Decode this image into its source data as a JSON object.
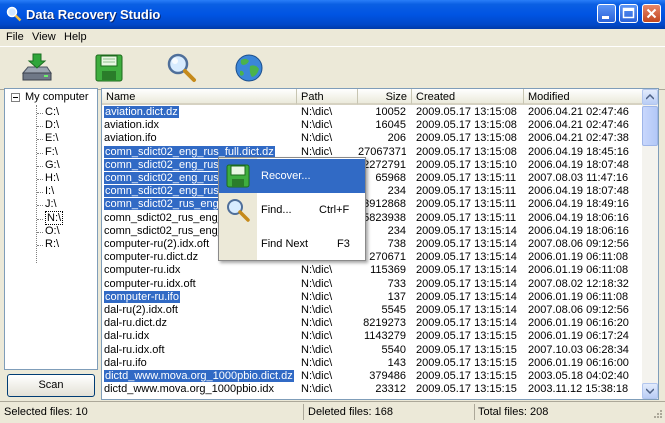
{
  "window": {
    "title": "Data Recovery Studio"
  },
  "menu": [
    "File",
    "View",
    "Help"
  ],
  "toolbar": [
    {
      "icon": "recover-drive-icon"
    },
    {
      "icon": "save-disk-icon"
    },
    {
      "icon": "magnifier-icon"
    },
    {
      "icon": "globe-icon"
    }
  ],
  "tree": {
    "root": "My computer",
    "drives": [
      "C:\\",
      "D:\\",
      "E:\\",
      "F:\\",
      "G:\\",
      "H:\\",
      "I:\\",
      "J:\\",
      "N:\\",
      "O:\\",
      "R:\\"
    ],
    "selected": "N:\\"
  },
  "scan_label": "Scan",
  "columns": {
    "name": "Name",
    "path": "Path",
    "size": "Size",
    "created": "Created",
    "modified": "Modified"
  },
  "rows": [
    {
      "name": "aviation.dict.dz",
      "path": "N:\\dic\\",
      "size": "10052",
      "created": "2009.05.17 13:15:08",
      "modified": "2006.04.21 02:47:46",
      "selected": true
    },
    {
      "name": "aviation.idx",
      "path": "N:\\dic\\",
      "size": "16045",
      "created": "2009.05.17 13:15:08",
      "modified": "2006.04.21 02:47:46",
      "selected": false
    },
    {
      "name": "aviation.ifo",
      "path": "N:\\dic\\",
      "size": "206",
      "created": "2009.05.17 13:15:08",
      "modified": "2006.04.21 02:47:38",
      "selected": false
    },
    {
      "name": "comn_sdict02_eng_rus_full.dict.dz",
      "path": "N:\\dic\\",
      "size": "27067371",
      "created": "2009.05.17 13:15:08",
      "modified": "2006.04.19 18:45:16",
      "selected": true
    },
    {
      "name": "comn_sdict02_eng_rus_full.idx",
      "path": "N:\\dic\\",
      "size": "2272791",
      "created": "2009.05.17 13:15:10",
      "modified": "2006.04.19 18:07:48",
      "selected": true
    },
    {
      "name": "comn_sdict02_eng_rus_full.ifo",
      "path": "N:\\dic\\",
      "size": "65968",
      "created": "2009.05.17 13:15:11",
      "modified": "2007.08.03 11:47:16",
      "selected": true
    },
    {
      "name": "comn_sdict02_eng_rus_full.ifo",
      "path": "N:\\dic\\",
      "size": "234",
      "created": "2009.05.17 13:15:11",
      "modified": "2006.04.19 18:07:48",
      "selected": true
    },
    {
      "name": "comn_sdict02_rus_eng_full.dict.dz",
      "path": "N:\\dic\\",
      "size": "3912868",
      "created": "2009.05.17 13:15:11",
      "modified": "2006.04.19 18:49:16",
      "selected": true
    },
    {
      "name": "comn_sdict02_rus_eng_full.idx",
      "path": "N:\\dic\\",
      "size": "5823938",
      "created": "2009.05.17 13:15:11",
      "modified": "2006.04.19 18:06:16",
      "selected": false
    },
    {
      "name": "comn_sdict02_rus_eng_full.ifo",
      "path": "N:\\dic\\",
      "size": "234",
      "created": "2009.05.17 13:15:14",
      "modified": "2006.04.19 18:06:16",
      "selected": false
    },
    {
      "name": "computer-ru(2).idx.oft",
      "path": "N:\\dic\\",
      "size": "738",
      "created": "2009.05.17 13:15:14",
      "modified": "2007.08.06 09:12:56",
      "selected": false
    },
    {
      "name": "computer-ru.dict.dz",
      "path": "N:\\dic\\",
      "size": "270671",
      "created": "2009.05.17 13:15:14",
      "modified": "2006.01.19 06:11:08",
      "selected": false
    },
    {
      "name": "computer-ru.idx",
      "path": "N:\\dic\\",
      "size": "115369",
      "created": "2009.05.17 13:15:14",
      "modified": "2006.01.19 06:11:08",
      "selected": false
    },
    {
      "name": "computer-ru.idx.oft",
      "path": "N:\\dic\\",
      "size": "733",
      "created": "2009.05.17 13:15:14",
      "modified": "2007.08.02 12:18:32",
      "selected": false
    },
    {
      "name": "computer-ru.ifo",
      "path": "N:\\dic\\",
      "size": "137",
      "created": "2009.05.17 13:15:14",
      "modified": "2006.01.19 06:11:08",
      "selected": true
    },
    {
      "name": "dal-ru(2).idx.oft",
      "path": "N:\\dic\\",
      "size": "5545",
      "created": "2009.05.17 13:15:14",
      "modified": "2007.08.06 09:12:56",
      "selected": false
    },
    {
      "name": "dal-ru.dict.dz",
      "path": "N:\\dic\\",
      "size": "8219273",
      "created": "2009.05.17 13:15:14",
      "modified": "2006.01.19 06:16:20",
      "selected": false
    },
    {
      "name": "dal-ru.idx",
      "path": "N:\\dic\\",
      "size": "1143279",
      "created": "2009.05.17 13:15:15",
      "modified": "2006.01.19 06:17:24",
      "selected": false
    },
    {
      "name": "dal-ru.idx.oft",
      "path": "N:\\dic\\",
      "size": "5540",
      "created": "2009.05.17 13:15:15",
      "modified": "2007.10.03 06:28:34",
      "selected": false
    },
    {
      "name": "dal-ru.ifo",
      "path": "N:\\dic\\",
      "size": "143",
      "created": "2009.05.17 13:15:15",
      "modified": "2006.01.19 06:16:00",
      "selected": false
    },
    {
      "name": "dictd_www.mova.org_1000pbio.dict.dz",
      "path": "N:\\dic\\",
      "size": "379486",
      "created": "2009.05.17 13:15:15",
      "modified": "2003.05.18 04:02:40",
      "selected": true
    },
    {
      "name": "dictd_www.mova.org_1000pbio.idx",
      "path": "N:\\dic\\",
      "size": "23312",
      "created": "2009.05.17 13:15:15",
      "modified": "2003.11.12 15:38:18",
      "selected": false
    }
  ],
  "context_menu": [
    {
      "label": "Recover...",
      "shortcut": "",
      "icon": "save-disk-icon",
      "highlighted": true
    },
    {
      "label": "Find...",
      "shortcut": "Ctrl+F",
      "icon": "magnifier-icon",
      "highlighted": false
    },
    {
      "label": "Find Next",
      "shortcut": "F3",
      "icon": "",
      "highlighted": false
    }
  ],
  "status": {
    "selected": "Selected files: 10",
    "deleted": "Deleted files: 168",
    "total": "Total files: 208"
  },
  "colors": {
    "selection": "#316ac5",
    "titlebar": "#0054e3",
    "face": "#ece9d8"
  }
}
